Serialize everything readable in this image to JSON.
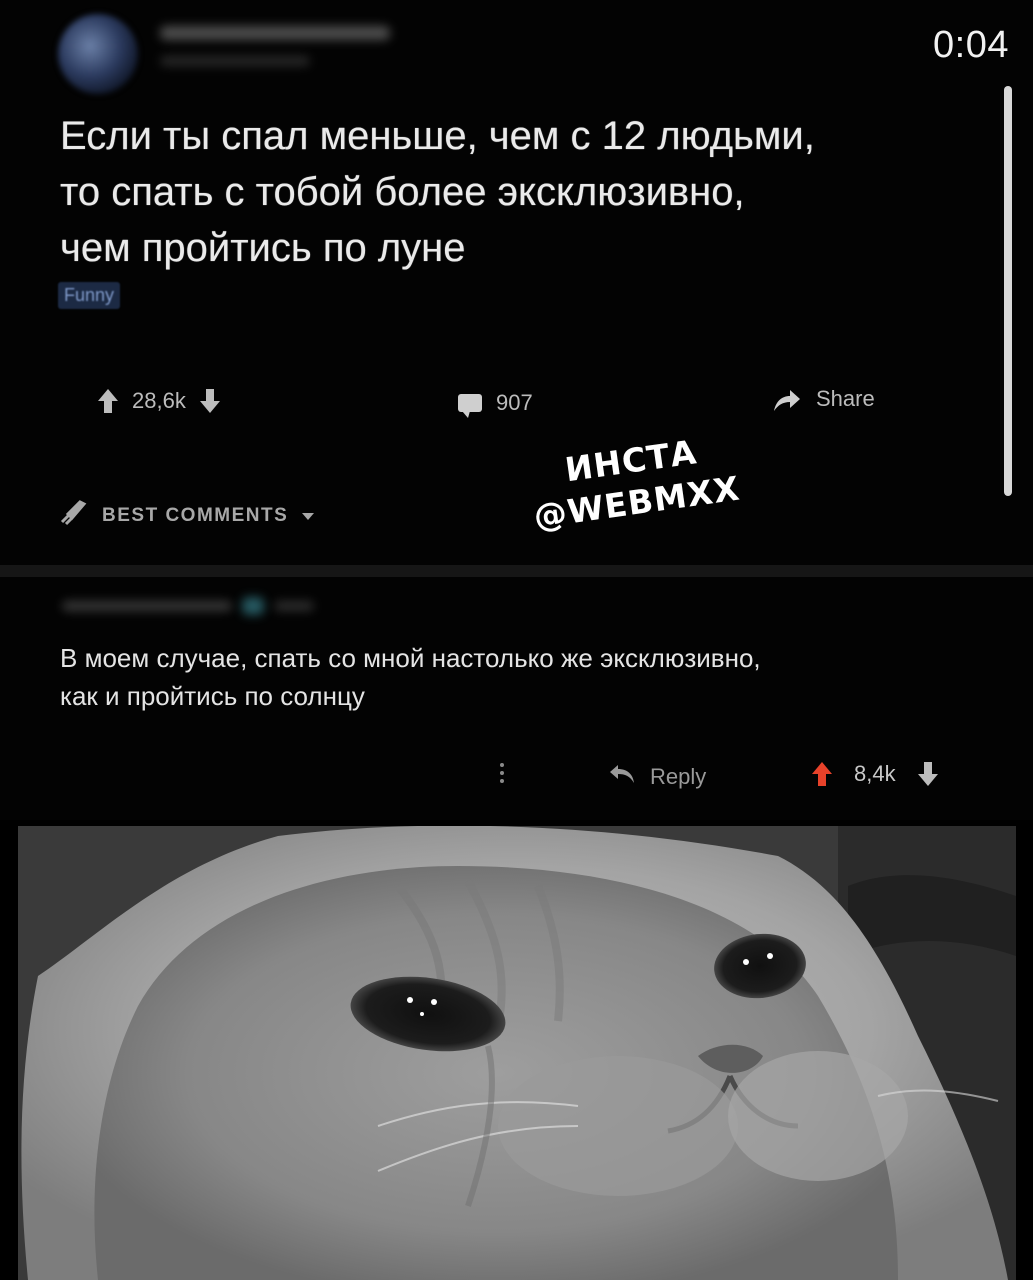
{
  "status_bar": {
    "time": "0:04"
  },
  "post": {
    "title": "Если ты спал меньше, чем с 12 людьми,\nто спать с тобой более эксклюзивно,\nчем пройтись по луне",
    "flair": "Funny",
    "upvotes": "28,6k",
    "comments_count": "907",
    "share_label": "Share",
    "sort_label": "BEST COMMENTS"
  },
  "watermark": {
    "line1": "ИНСТА",
    "line2": "@WEBMXX"
  },
  "comment": {
    "text": "В моем случае, спать со мной настолько же эксклюзивно,\nкак и пройтись по солнцу",
    "reply_label": "Reply",
    "upvotes": "8,4k"
  },
  "colors": {
    "background": "#000000",
    "upvote_active": "#e8422a",
    "text": "#e8e8e8",
    "muted": "#a8a8a8"
  },
  "icons": [
    "avatar",
    "upvote-icon",
    "downvote-icon",
    "comment-icon",
    "share-icon",
    "rocket-icon",
    "chevron-down-icon",
    "more-icon",
    "reply-icon"
  ]
}
